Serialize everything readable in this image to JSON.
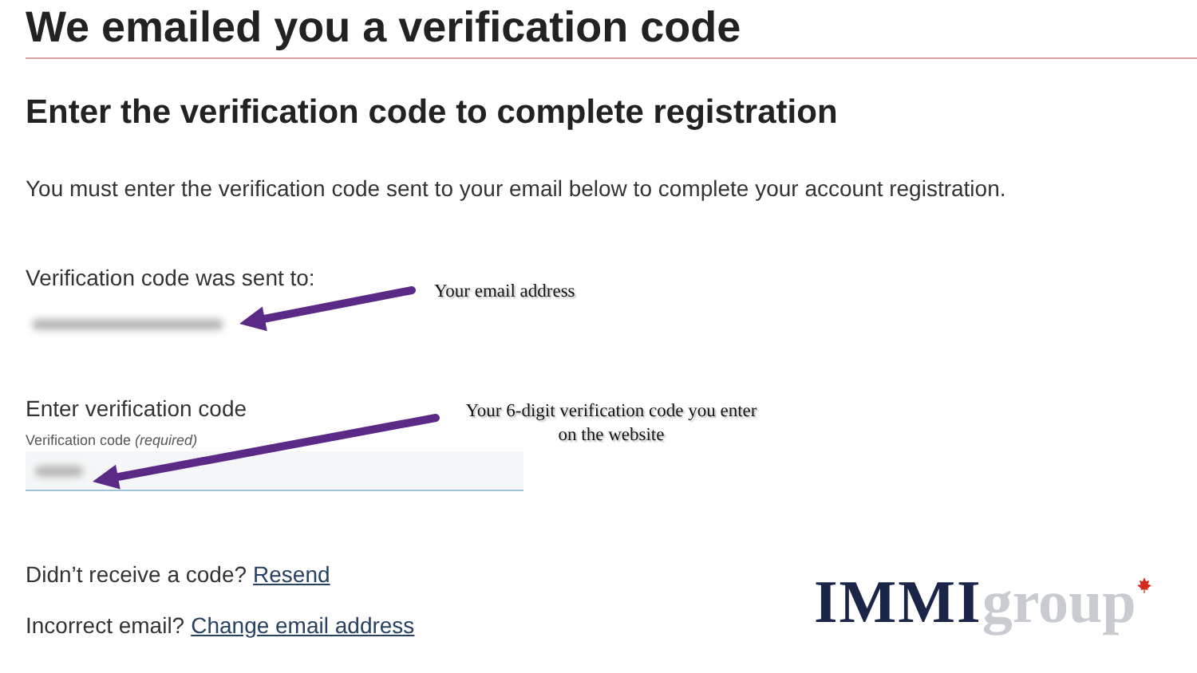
{
  "heading": "We emailed you a verification code",
  "subheading": "Enter the verification code to complete registration",
  "intro": "You must enter the verification code sent to your email below to complete your account registration.",
  "sent_to": {
    "label": "Verification code was sent to:"
  },
  "code_field": {
    "heading": "Enter verification code",
    "label": "Verification code *(required)*"
  },
  "resend": {
    "text": "Didn’t receive a code?",
    "link": "Resend"
  },
  "change_email": {
    "text": "Incorrect email?",
    "link": "Change email address"
  },
  "annotations": [
    {
      "text": "Your email address"
    },
    {
      "text": "Your 6-digit verification code you enter on the website"
    }
  ],
  "logo": {
    "primary": "IMMI",
    "secondary": "group"
  }
}
